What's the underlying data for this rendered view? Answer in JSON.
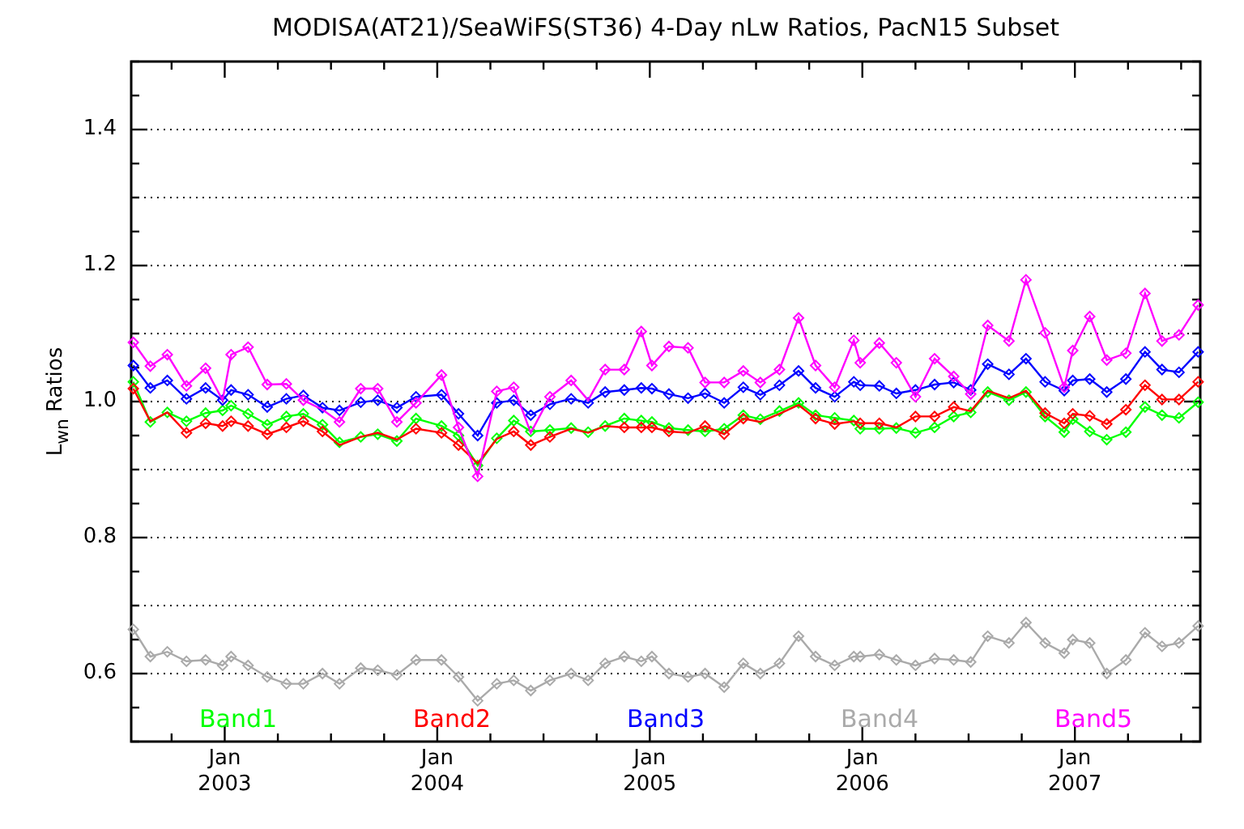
{
  "chart_data": {
    "type": "line",
    "title": "MODISA(AT21)/SeaWiFS(ST36) 4-Day nLw Ratios, PacN15 Subset",
    "ylabel": "L$_{wn}$ Ratios",
    "x": [
      2002.57,
      2002.65,
      2002.73,
      2002.82,
      2002.91,
      2002.99,
      2003.03,
      2003.11,
      2003.2,
      2003.29,
      2003.37,
      2003.46,
      2003.54,
      2003.64,
      2003.72,
      2003.81,
      2003.9,
      2004.02,
      2004.1,
      2004.19,
      2004.28,
      2004.36,
      2004.44,
      2004.53,
      2004.63,
      2004.71,
      2004.79,
      2004.88,
      2004.96,
      2005.01,
      2005.09,
      2005.18,
      2005.26,
      2005.35,
      2005.44,
      2005.52,
      2005.61,
      2005.7,
      2005.78,
      2005.87,
      2005.96,
      2005.99,
      2006.08,
      2006.16,
      2006.25,
      2006.34,
      2006.43,
      2006.51,
      2006.59,
      2006.69,
      2006.77,
      2006.86,
      2006.95,
      2006.99,
      2007.07,
      2007.15,
      2007.24,
      2007.33,
      2007.41,
      2007.49,
      2007.58
    ],
    "series": [
      {
        "name": "Band1",
        "color": "#00ff00",
        "marker": "diamond",
        "values": [
          1.029,
          0.97,
          0.984,
          0.971,
          0.983,
          0.987,
          0.994,
          0.982,
          0.966,
          0.978,
          0.982,
          0.966,
          0.94,
          0.948,
          0.952,
          0.942,
          0.975,
          0.964,
          0.95,
          0.906,
          0.946,
          0.972,
          0.956,
          0.958,
          0.961,
          0.955,
          0.964,
          0.975,
          0.972,
          0.97,
          0.961,
          0.958,
          0.956,
          0.96,
          0.98,
          0.974,
          0.986,
          0.998,
          0.98,
          0.976,
          0.972,
          0.96,
          0.96,
          0.961,
          0.954,
          0.962,
          0.978,
          0.984,
          1.014,
          1.002,
          1.014,
          0.978,
          0.955,
          0.974,
          0.956,
          0.944,
          0.955,
          0.992,
          0.98,
          0.976,
          0.999
        ]
      },
      {
        "name": "Band2",
        "color": "#ff0000",
        "marker": "diamond",
        "values": [
          1.019,
          0.971,
          0.984,
          0.954,
          0.968,
          0.964,
          0.971,
          0.964,
          0.952,
          0.962,
          0.971,
          0.956,
          0.936,
          0.948,
          0.954,
          0.944,
          0.96,
          0.954,
          0.936,
          0.909,
          0.945,
          0.956,
          0.936,
          0.948,
          0.96,
          0.954,
          0.964,
          0.962,
          0.962,
          0.962,
          0.956,
          0.954,
          0.964,
          0.952,
          0.975,
          0.97,
          0.982,
          0.995,
          0.975,
          0.967,
          0.971,
          0.968,
          0.968,
          0.962,
          0.978,
          0.978,
          0.992,
          0.986,
          1.016,
          1.005,
          1.016,
          0.983,
          0.968,
          0.982,
          0.979,
          0.967,
          0.988,
          1.024,
          1.003,
          1.003,
          1.029
        ]
      },
      {
        "name": "Band3",
        "color": "#0000ff",
        "marker": "diamond",
        "values": [
          1.053,
          1.02,
          1.031,
          1.004,
          1.02,
          1.002,
          1.017,
          1.01,
          0.992,
          1.004,
          1.009,
          0.991,
          0.987,
          0.999,
          1.002,
          0.991,
          1.007,
          1.01,
          0.982,
          0.95,
          0.998,
          1.002,
          0.98,
          0.996,
          1.004,
          0.998,
          1.014,
          1.017,
          1.02,
          1.019,
          1.011,
          1.005,
          1.012,
          0.998,
          1.021,
          1.01,
          1.024,
          1.045,
          1.02,
          1.007,
          1.029,
          1.024,
          1.023,
          1.012,
          1.017,
          1.025,
          1.028,
          1.017,
          1.055,
          1.04,
          1.063,
          1.029,
          1.016,
          1.031,
          1.033,
          1.014,
          1.033,
          1.073,
          1.047,
          1.043,
          1.073
        ]
      },
      {
        "name": "Band4",
        "color": "#aaaaaa",
        "marker": "diamond",
        "values": [
          0.665,
          0.625,
          0.632,
          0.618,
          0.62,
          0.612,
          0.625,
          0.612,
          0.595,
          0.585,
          0.585,
          0.6,
          0.585,
          0.608,
          0.605,
          0.598,
          0.62,
          0.62,
          0.595,
          0.56,
          0.585,
          0.59,
          0.575,
          0.59,
          0.6,
          0.59,
          0.615,
          0.625,
          0.618,
          0.625,
          0.6,
          0.595,
          0.6,
          0.58,
          0.615,
          0.6,
          0.615,
          0.655,
          0.625,
          0.612,
          0.625,
          0.625,
          0.628,
          0.62,
          0.612,
          0.622,
          0.62,
          0.617,
          0.655,
          0.645,
          0.675,
          0.645,
          0.63,
          0.65,
          0.645,
          0.6,
          0.62,
          0.66,
          0.64,
          0.645,
          0.67
        ]
      },
      {
        "name": "Band5",
        "color": "#ff00ff",
        "marker": "diamond",
        "values": [
          1.087,
          1.052,
          1.069,
          1.023,
          1.049,
          1.002,
          1.069,
          1.08,
          1.025,
          1.026,
          1.002,
          0.988,
          0.97,
          1.019,
          1.019,
          0.97,
          0.998,
          1.039,
          0.962,
          0.89,
          1.015,
          1.021,
          0.954,
          1.007,
          1.031,
          1.002,
          1.047,
          1.047,
          1.103,
          1.053,
          1.081,
          1.079,
          1.028,
          1.028,
          1.045,
          1.028,
          1.047,
          1.123,
          1.053,
          1.021,
          1.09,
          1.057,
          1.086,
          1.057,
          1.007,
          1.063,
          1.037,
          1.011,
          1.112,
          1.089,
          1.179,
          1.101,
          1.021,
          1.075,
          1.125,
          1.061,
          1.071,
          1.159,
          1.089,
          1.098,
          1.142
        ]
      }
    ],
    "xlim": [
      2002.56,
      2007.59
    ],
    "ylim": [
      0.5,
      1.5
    ],
    "grid": true,
    "xticks": [
      2003,
      2004,
      2005,
      2006,
      2007
    ],
    "annotations": [
      "Jan",
      "Jan",
      "Jan",
      "Jan",
      "Jan"
    ],
    "yticks": [
      {
        "value": 0.6,
        "label": "0.6"
      },
      {
        "value": 0.8,
        "label": "0.8"
      },
      {
        "value": 1.0,
        "label": "1.0"
      },
      {
        "value": 1.2,
        "label": "1.2"
      },
      {
        "value": 1.4,
        "label": "1.4"
      }
    ]
  }
}
